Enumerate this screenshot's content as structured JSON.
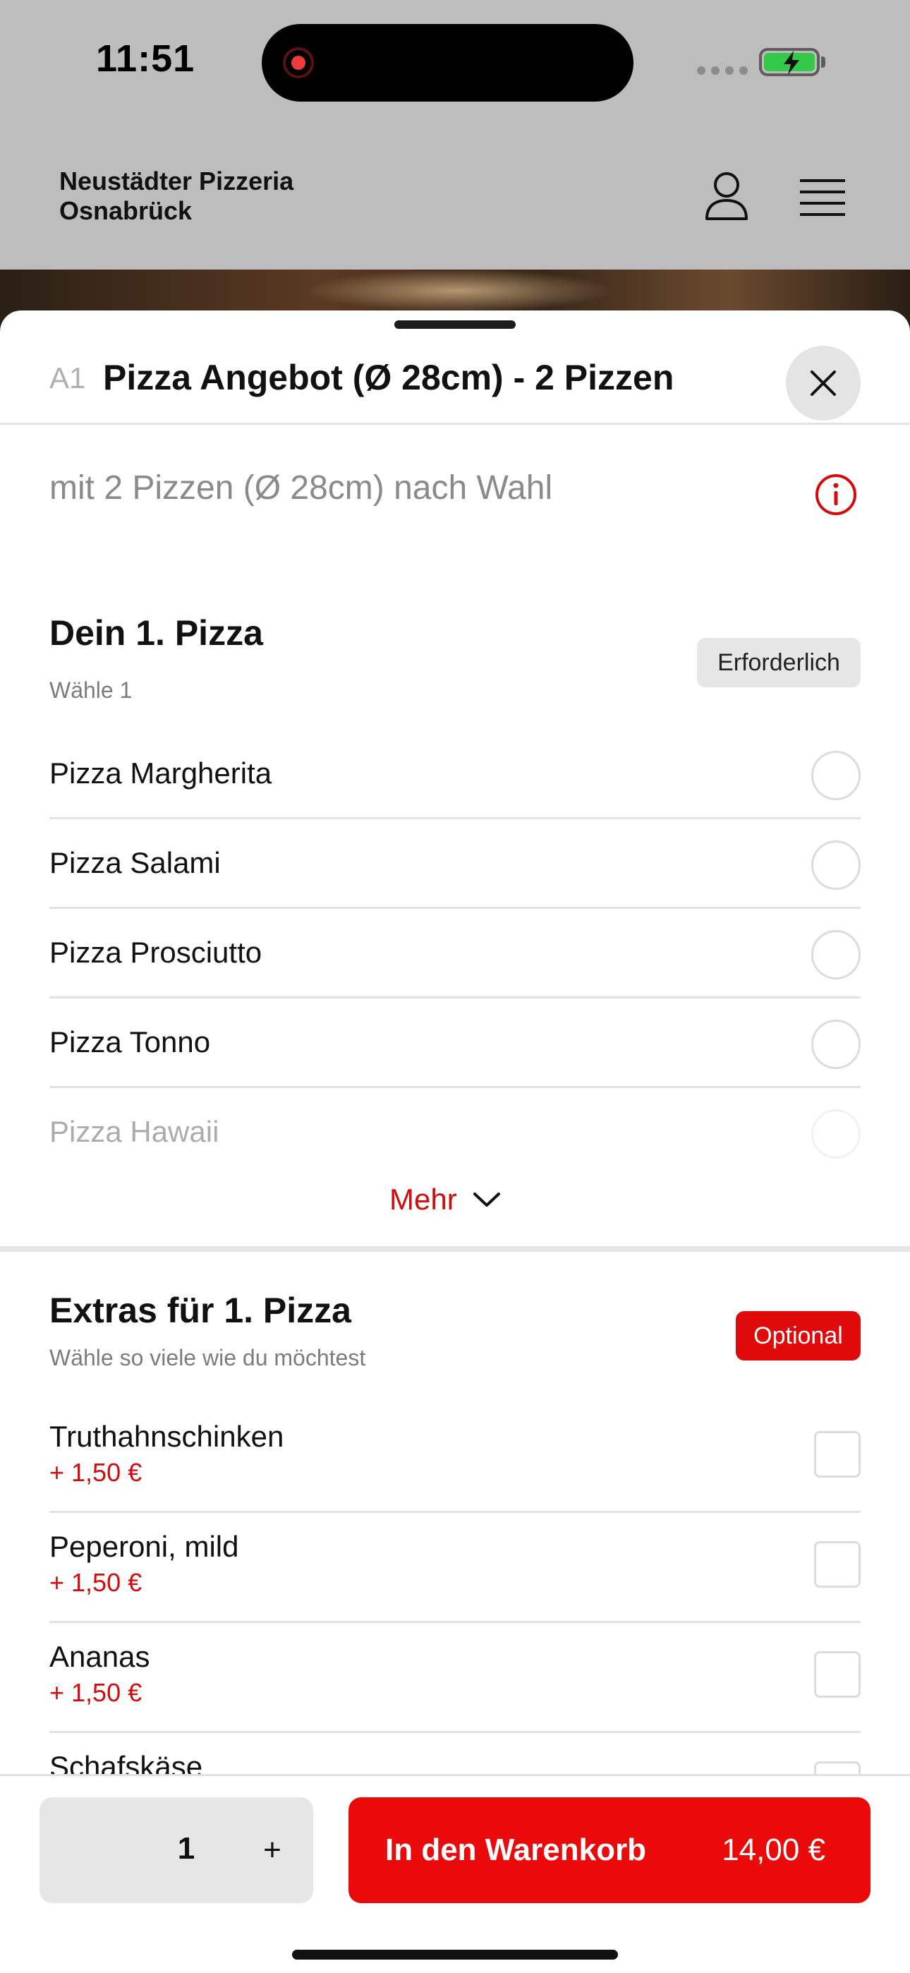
{
  "status_bar": {
    "time": "11:51"
  },
  "header": {
    "store_name_line1": "Neustädter Pizzeria",
    "store_name_line2": "Osnabrück",
    "icons": [
      "user-icon",
      "menu-icon"
    ]
  },
  "product": {
    "code": "A1",
    "title": "Pizza Angebot (Ø 28cm) - 2 Pizzen",
    "description": "mit 2 Pizzen (Ø 28cm) nach Wahl"
  },
  "group1": {
    "title": "Dein 1. Pizza",
    "subtitle": "Wähle 1",
    "badge": "Erforderlich",
    "options": [
      {
        "label": "Pizza Margherita"
      },
      {
        "label": "Pizza Salami"
      },
      {
        "label": "Pizza Prosciutto"
      },
      {
        "label": "Pizza Tonno"
      },
      {
        "label": "Pizza Hawaii"
      }
    ],
    "more_label": "Mehr"
  },
  "group2": {
    "title": "Extras für 1. Pizza",
    "subtitle": "Wähle so viele wie du möchtest",
    "badge": "Optional",
    "options": [
      {
        "name": "Truthahnschinken",
        "price": "+ 1,50 €"
      },
      {
        "name": "Peperoni, mild",
        "price": "+ 1,50 €"
      },
      {
        "name": "Ananas",
        "price": "+ 1,50 €"
      },
      {
        "name": "Schafskäse"
      }
    ]
  },
  "footer": {
    "quantity": "1",
    "plus_label": "+",
    "add_to_cart_label": "In den Warenkorb",
    "total_price": "14,00 €"
  },
  "colors": {
    "accent": "#e10a0a",
    "overlay_gray": "#bdbdbd"
  }
}
